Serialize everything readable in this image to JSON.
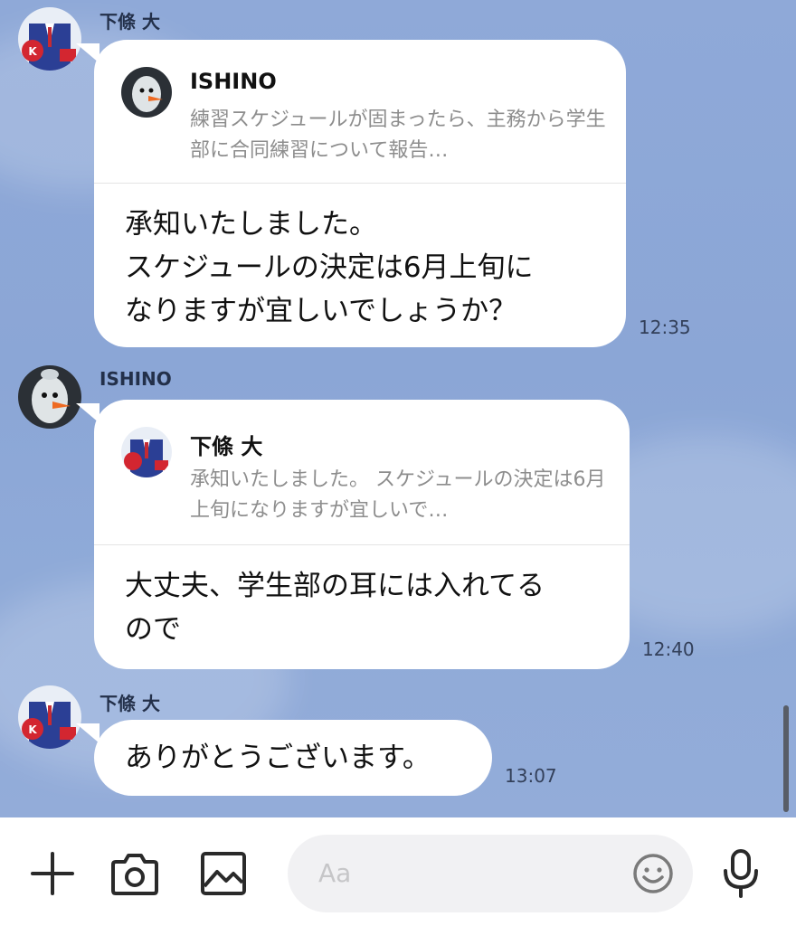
{
  "messages": [
    {
      "sender": "下條 大",
      "reply_to": {
        "name": "ISHINO",
        "preview": "練習スケジュールが固まったら、主務から学生部に合同練習について報告…"
      },
      "text": "承知いたしました。\nスケジュールの決定は6月上旬に\nなりますが宜しいでしょうか？",
      "time": "12:35"
    },
    {
      "sender": "ISHINO",
      "reply_to": {
        "name": "下條 大",
        "preview": "承知いたしました。 スケジュールの決定は6月上旬になりますが宜しいで…"
      },
      "text": "大丈夫、学生部の耳には入れてる\nので",
      "time": "12:40"
    },
    {
      "sender": "下條 大",
      "text": "ありがとうございます。",
      "time": "13:07"
    }
  ],
  "input": {
    "placeholder": "Aa"
  },
  "toolbar": {
    "icons": [
      "plus-icon",
      "camera-icon",
      "image-icon",
      "emoji-icon",
      "microphone-icon"
    ]
  },
  "colors": {
    "chat_background": "#8ba6d6",
    "bubble": "#ffffff",
    "meta_text": "#33405a"
  }
}
